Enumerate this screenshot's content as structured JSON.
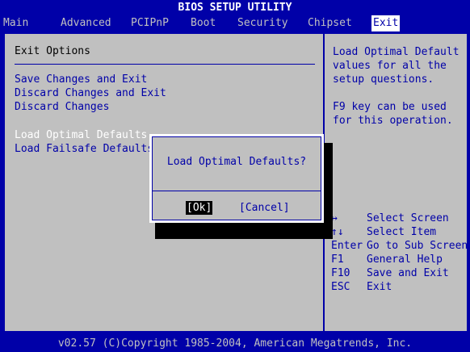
{
  "title": "BIOS SETUP UTILITY",
  "menu": {
    "items": [
      {
        "label": "Main"
      },
      {
        "label": "Advanced"
      },
      {
        "label": "PCIPnP"
      },
      {
        "label": "Boot"
      },
      {
        "label": "Security"
      },
      {
        "label": "Chipset"
      },
      {
        "label": "Exit"
      }
    ],
    "active": "Exit"
  },
  "main": {
    "section_title": "Exit Options",
    "options": [
      {
        "label": "Save Changes and Exit"
      },
      {
        "label": "Discard Changes and Exit"
      },
      {
        "label": "Discard Changes"
      },
      {
        "label": "Load Optimal Defaults"
      },
      {
        "label": "Load Failsafe Defaults"
      }
    ],
    "selected": "Load Optimal Defaults"
  },
  "help": {
    "description": "Load Optimal Default\nvalues for all the\nsetup questions.\n\nF9 key can be used\nfor this operation.",
    "keys": [
      {
        "key": "↔",
        "desc": "Select Screen"
      },
      {
        "key": "↑↓",
        "desc": "Select Item"
      },
      {
        "key": "Enter",
        "desc": "Go to Sub Screen"
      },
      {
        "key": "F1",
        "desc": "General Help"
      },
      {
        "key": "F10",
        "desc": "Save and Exit"
      },
      {
        "key": "ESC",
        "desc": "Exit"
      }
    ]
  },
  "dialog": {
    "message": "Load Optimal Defaults?",
    "ok_label": "[Ok]",
    "cancel_label": "[Cancel]"
  },
  "footer": "v02.57 (C)Copyright 1985-2004, American Megatrends, Inc.",
  "colors": {
    "background": "#0000a8",
    "panel": "#c0c0c0",
    "text": "#0000a8",
    "highlight": "#ffffff"
  }
}
